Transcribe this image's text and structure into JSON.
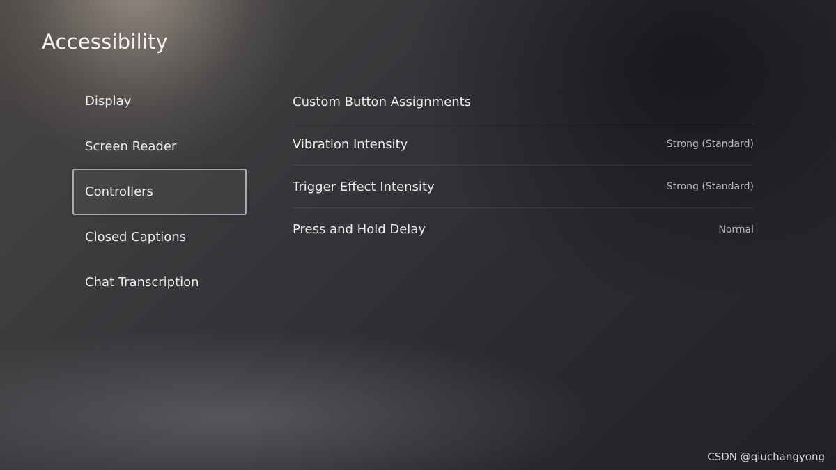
{
  "page": {
    "title": "Accessibility"
  },
  "sidebar": {
    "selected_index": 2,
    "items": [
      {
        "label": "Display"
      },
      {
        "label": "Screen Reader"
      },
      {
        "label": "Controllers"
      },
      {
        "label": "Closed Captions"
      },
      {
        "label": "Chat Transcription"
      }
    ]
  },
  "settings": {
    "rows": [
      {
        "label": "Custom Button Assignments",
        "value": ""
      },
      {
        "label": "Vibration Intensity",
        "value": "Strong (Standard)"
      },
      {
        "label": "Trigger Effect Intensity",
        "value": "Strong (Standard)"
      },
      {
        "label": "Press and Hold Delay",
        "value": "Normal"
      }
    ]
  },
  "watermark": {
    "text": "CSDN @qiuchangyong"
  },
  "colors": {
    "text_primary": "#ececec",
    "text_secondary": "#b9b9bb",
    "selection_border": "#cdcdd2"
  }
}
